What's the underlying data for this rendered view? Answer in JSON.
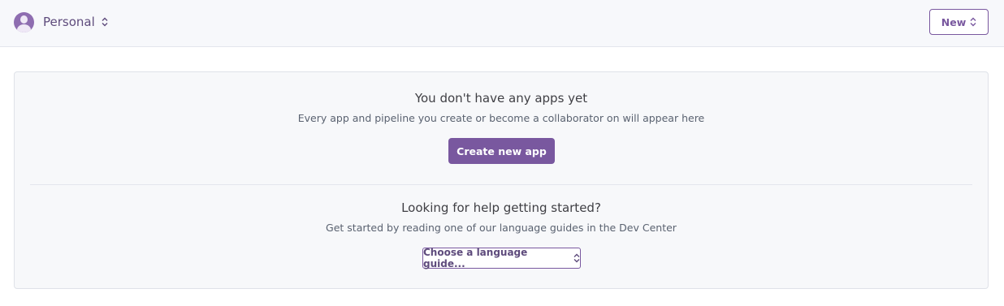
{
  "header": {
    "account_name": "Personal",
    "account_icon": "user-avatar-icon",
    "new_label": "New"
  },
  "empty_state": {
    "title": "You don't have any apps yet",
    "subtitle": "Every app and pipeline you create or become a collaborator on will appear here",
    "create_button": "Create new app"
  },
  "help": {
    "title": "Looking for help getting started?",
    "subtitle": "Get started by reading one of our language guides in the Dev Center",
    "select_value": "Choose a language guide..."
  },
  "colors": {
    "accent": "#79589f",
    "topbar_bg": "#f7f8fb",
    "panel_bg": "#f7f8fa"
  }
}
